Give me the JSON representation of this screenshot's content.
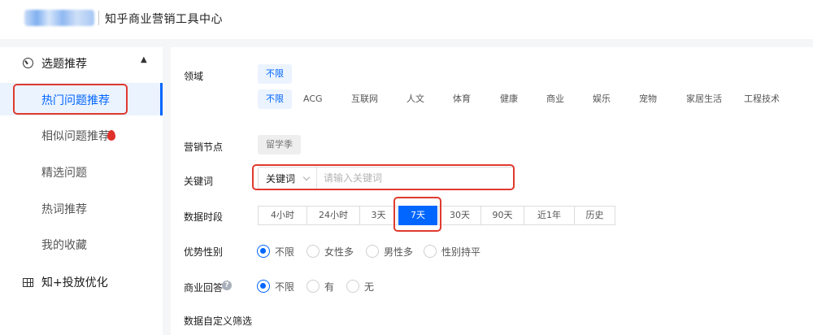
{
  "header": {
    "title": "知乎商业营销工具中心"
  },
  "sidebar": {
    "group1": {
      "label": "选题推荐"
    },
    "items": [
      {
        "label": "热门问题推荐"
      },
      {
        "label": "相似问题推荐"
      },
      {
        "label": "精选问题"
      },
      {
        "label": "热词推荐"
      },
      {
        "label": "我的收藏"
      }
    ],
    "group2": {
      "label": "知+投放优化"
    }
  },
  "filters": {
    "domain": {
      "label": "领域",
      "selected_top": "不限",
      "options": [
        "不限",
        "ACG",
        "互联网",
        "人文",
        "体育",
        "健康",
        "商业",
        "娱乐",
        "宠物",
        "家居生活",
        "工程技术"
      ]
    },
    "node": {
      "label": "营销节点",
      "tag": "留学季"
    },
    "keyword": {
      "label": "关键词",
      "select_value": "关键词",
      "placeholder": "请输入关键词"
    },
    "period": {
      "label": "数据时段",
      "options": [
        "4小时",
        "24小时",
        "3天",
        "7天",
        "30天",
        "90天",
        "近1年",
        "历史"
      ],
      "selected": "7天"
    },
    "gender": {
      "label": "优势性别",
      "options": [
        "不限",
        "女性多",
        "男性多",
        "性别持平"
      ],
      "selected": "不限"
    },
    "commercial": {
      "label": "商业回答",
      "options": [
        "不限",
        "有",
        "无"
      ],
      "selected": "不限"
    },
    "custom": {
      "label": "数据自定义筛选"
    }
  },
  "colors": {
    "accent": "#0066ff",
    "highlight": "#e03a2f"
  }
}
